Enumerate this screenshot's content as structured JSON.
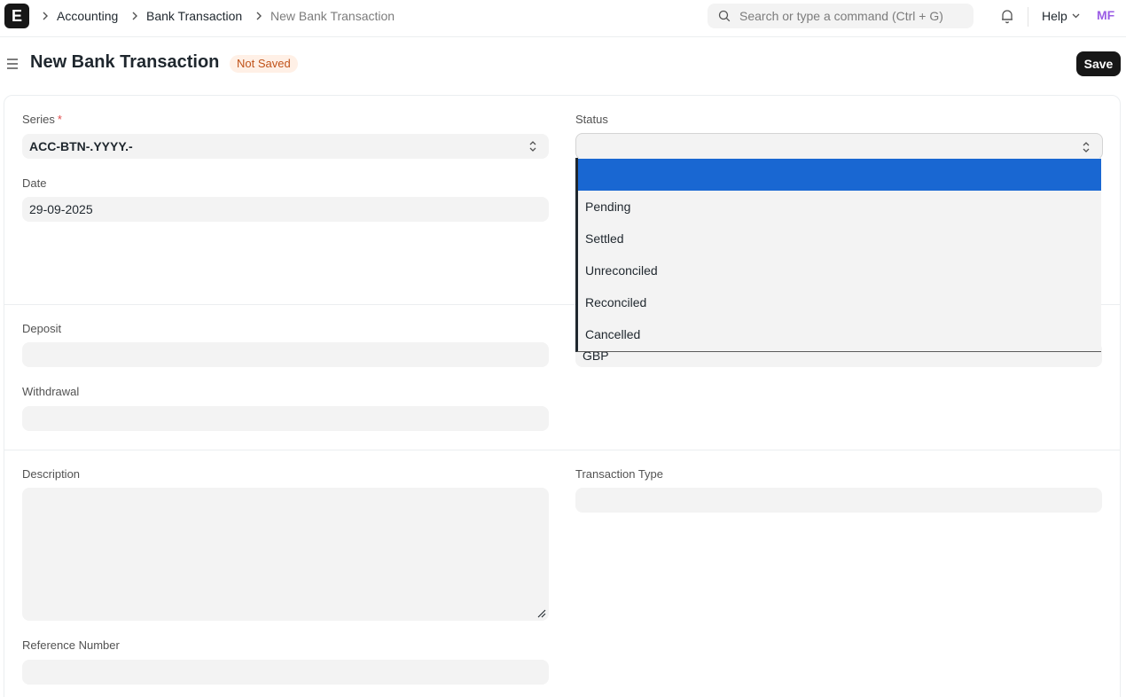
{
  "navbar": {
    "logo_letter": "E",
    "breadcrumbs": [
      "Accounting",
      "Bank Transaction",
      "New Bank Transaction"
    ],
    "search_placeholder": "Search or type a command (Ctrl + G)",
    "help_label": "Help",
    "avatar_initials": "MF"
  },
  "page": {
    "title": "New Bank Transaction",
    "status_badge": "Not Saved",
    "save_label": "Save"
  },
  "form": {
    "series": {
      "label": "Series",
      "required_mark": "*",
      "value": "ACC-BTN-.YYYY.-"
    },
    "date": {
      "label": "Date",
      "value": "29-09-2025"
    },
    "status": {
      "label": "Status",
      "value": "",
      "options": [
        "",
        "Pending",
        "Settled",
        "Unreconciled",
        "Reconciled",
        "Cancelled"
      ],
      "highlighted_index": 0
    },
    "deposit": {
      "label": "Deposit",
      "value": ""
    },
    "withdrawal": {
      "label": "Withdrawal",
      "value": ""
    },
    "currency": {
      "value": "GBP"
    },
    "description": {
      "label": "Description",
      "value": ""
    },
    "transaction_type": {
      "label": "Transaction Type",
      "value": ""
    },
    "reference_number": {
      "label": "Reference Number",
      "value": ""
    }
  },
  "colors": {
    "highlight": "#1967d2",
    "badge_bg": "#fff0e6",
    "badge_text": "#c0531a",
    "avatar": "#9b5de5",
    "primary_button": "#171717"
  }
}
